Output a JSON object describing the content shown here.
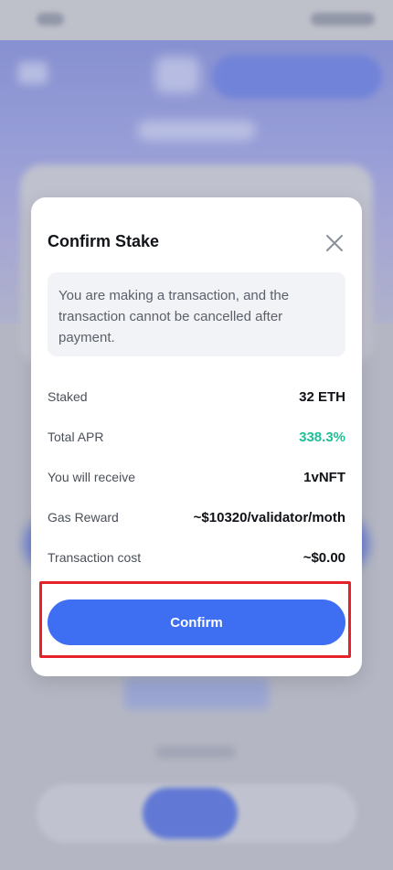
{
  "modal": {
    "title": "Confirm Stake",
    "notice": "You are making a transaction, and the transaction cannot be cancelled after payment.",
    "rows": [
      {
        "label": "Staked",
        "value": "32 ETH"
      },
      {
        "label": "Total APR",
        "value": "338.3%"
      },
      {
        "label": "You will receive",
        "value": "1vNFT"
      },
      {
        "label": "Gas Reward",
        "value": "~$10320/validator/moth"
      },
      {
        "label": "Transaction cost",
        "value": "~$0.00"
      }
    ],
    "confirm_label": "Confirm"
  },
  "colors": {
    "accent": "#3e6ef2",
    "positive": "#1fbf98",
    "highlight": "#e5222a"
  }
}
